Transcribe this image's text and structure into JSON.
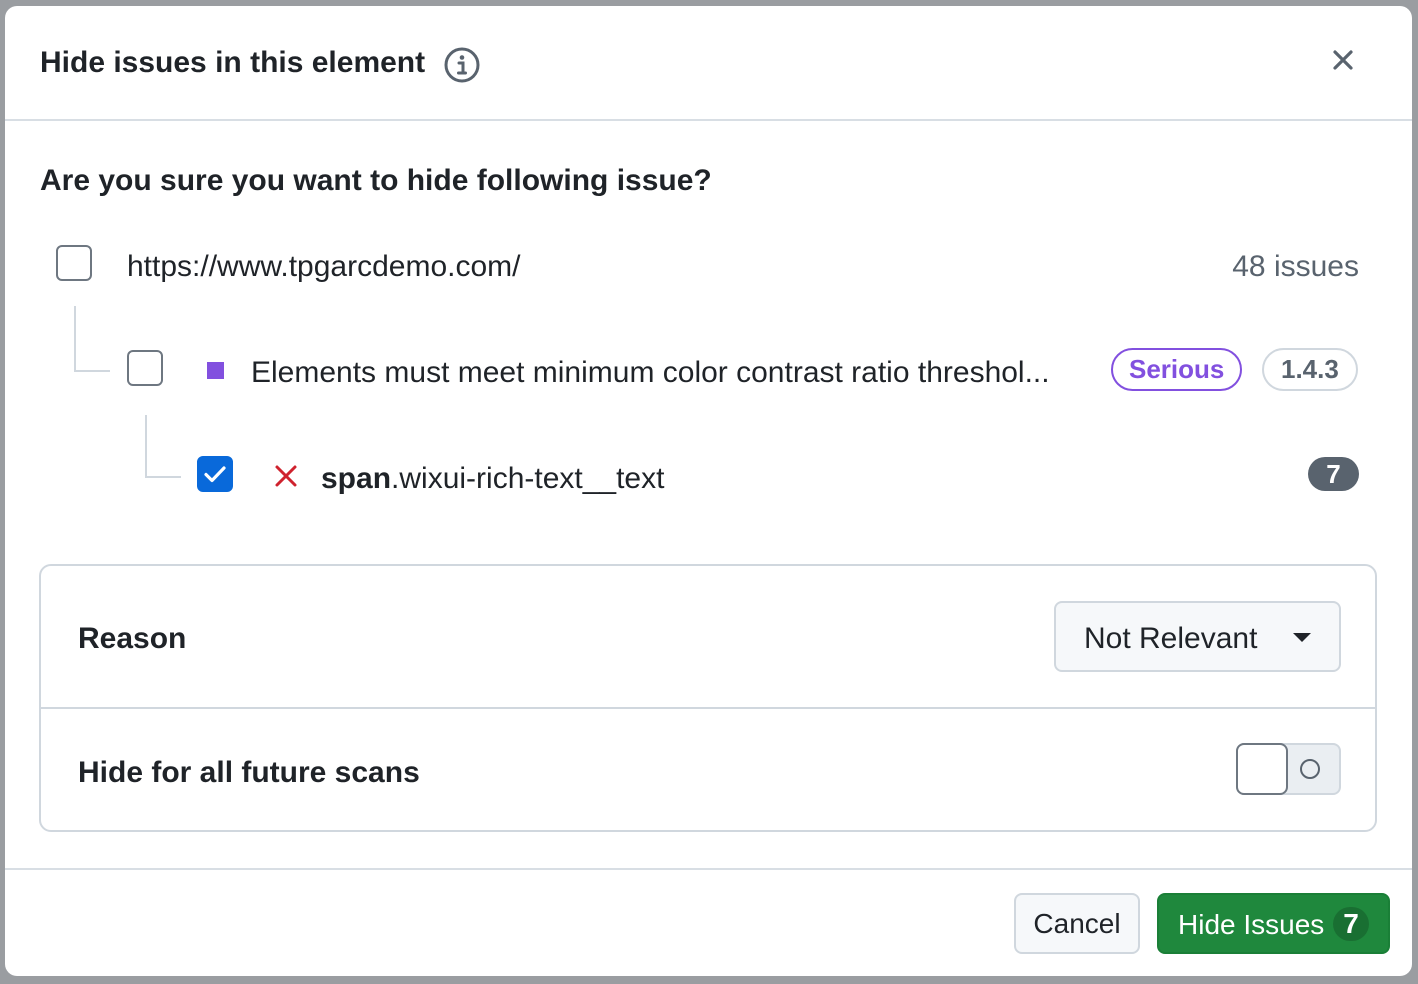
{
  "dialog": {
    "title": "Hide issues in this element",
    "question": "Are you sure you want to hide following issue?",
    "icons": {
      "info": "info-icon",
      "close": "close-icon",
      "remove": "x-icon"
    }
  },
  "tree": {
    "url": {
      "label": "https://www.tpgarcdemo.com/",
      "issues": "48 issues",
      "checked": false
    },
    "rule": {
      "label": "Elements must meet minimum color contrast ratio threshol...",
      "severity": "Serious",
      "severity_color": "#8250df",
      "criterion": "1.4.3",
      "checked": false
    },
    "element": {
      "tag": "span",
      "class": ".wixui-rich-text__text",
      "count": "7",
      "checked": true
    }
  },
  "settings": {
    "reason_label": "Reason",
    "reason_value": "Not Relevant",
    "future_label": "Hide for all future scans",
    "future_enabled": false
  },
  "footer": {
    "cancel_label": "Cancel",
    "hide_label": "Hide Issues",
    "hide_count": "7",
    "primary_color": "#1f883d"
  }
}
